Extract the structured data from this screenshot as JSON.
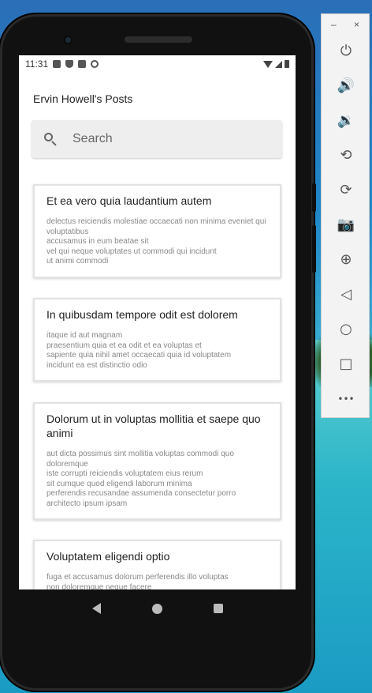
{
  "colors": {
    "screen_bg": "#ffffff",
    "card_border": "#e2e2e2",
    "search_bg": "#eeeeee",
    "title_text": "#222222",
    "body_text": "#888888"
  },
  "status_bar": {
    "time": "11:31"
  },
  "page": {
    "title": "Ervin Howell's Posts"
  },
  "search": {
    "placeholder": "Search",
    "value": ""
  },
  "posts": [
    {
      "title": "Et ea vero quia laudantium autem",
      "body": "delectus reiciendis molestiae occaecati non minima eveniet qui voluptatibus\naccusamus in eum beatae sit\nvel qui neque voluptates ut commodi qui incidunt\nut animi commodi"
    },
    {
      "title": "In quibusdam tempore odit est dolorem",
      "body": "itaque id aut magnam\npraesentium quia et ea odit et ea voluptas et\nsapiente quia nihil amet occaecati quia id voluptatem\nincidunt ea est distinctio odio"
    },
    {
      "title": "Dolorum ut in voluptas mollitia et saepe quo animi",
      "body": "aut dicta possimus sint mollitia voluptas commodi quo doloremque\niste corrupti reiciendis voluptatem eius rerum\nsit cumque quod eligendi laborum minima\nperferendis recusandae assumenda consectetur porro\narchitecto ipsum ipsam"
    },
    {
      "title": "Voluptatem eligendi optio",
      "body": "fuga et accusamus dolorum perferendis illo voluptas\nnon doloremque neque facere"
    }
  ],
  "nav_bar": {
    "icons": [
      "back-icon",
      "home-icon",
      "recents-icon"
    ]
  },
  "emulator_toolbar": {
    "window_controls": {
      "minimize": "–",
      "close": "×"
    },
    "items": [
      {
        "name": "power-icon",
        "glyph": "⏻"
      },
      {
        "name": "volume-up-icon",
        "glyph": "🔊"
      },
      {
        "name": "volume-down-icon",
        "glyph": "🔉"
      },
      {
        "name": "rotate-left-icon",
        "glyph": "⟲"
      },
      {
        "name": "rotate-right-icon",
        "glyph": "⟳"
      },
      {
        "name": "camera-icon",
        "glyph": "📷"
      },
      {
        "name": "zoom-icon",
        "glyph": "⊕"
      },
      {
        "name": "back-icon",
        "glyph": "◁"
      },
      {
        "name": "home-icon",
        "glyph": "○"
      },
      {
        "name": "overview-icon",
        "glyph": "□"
      },
      {
        "name": "more-icon",
        "glyph": "•••"
      }
    ]
  }
}
